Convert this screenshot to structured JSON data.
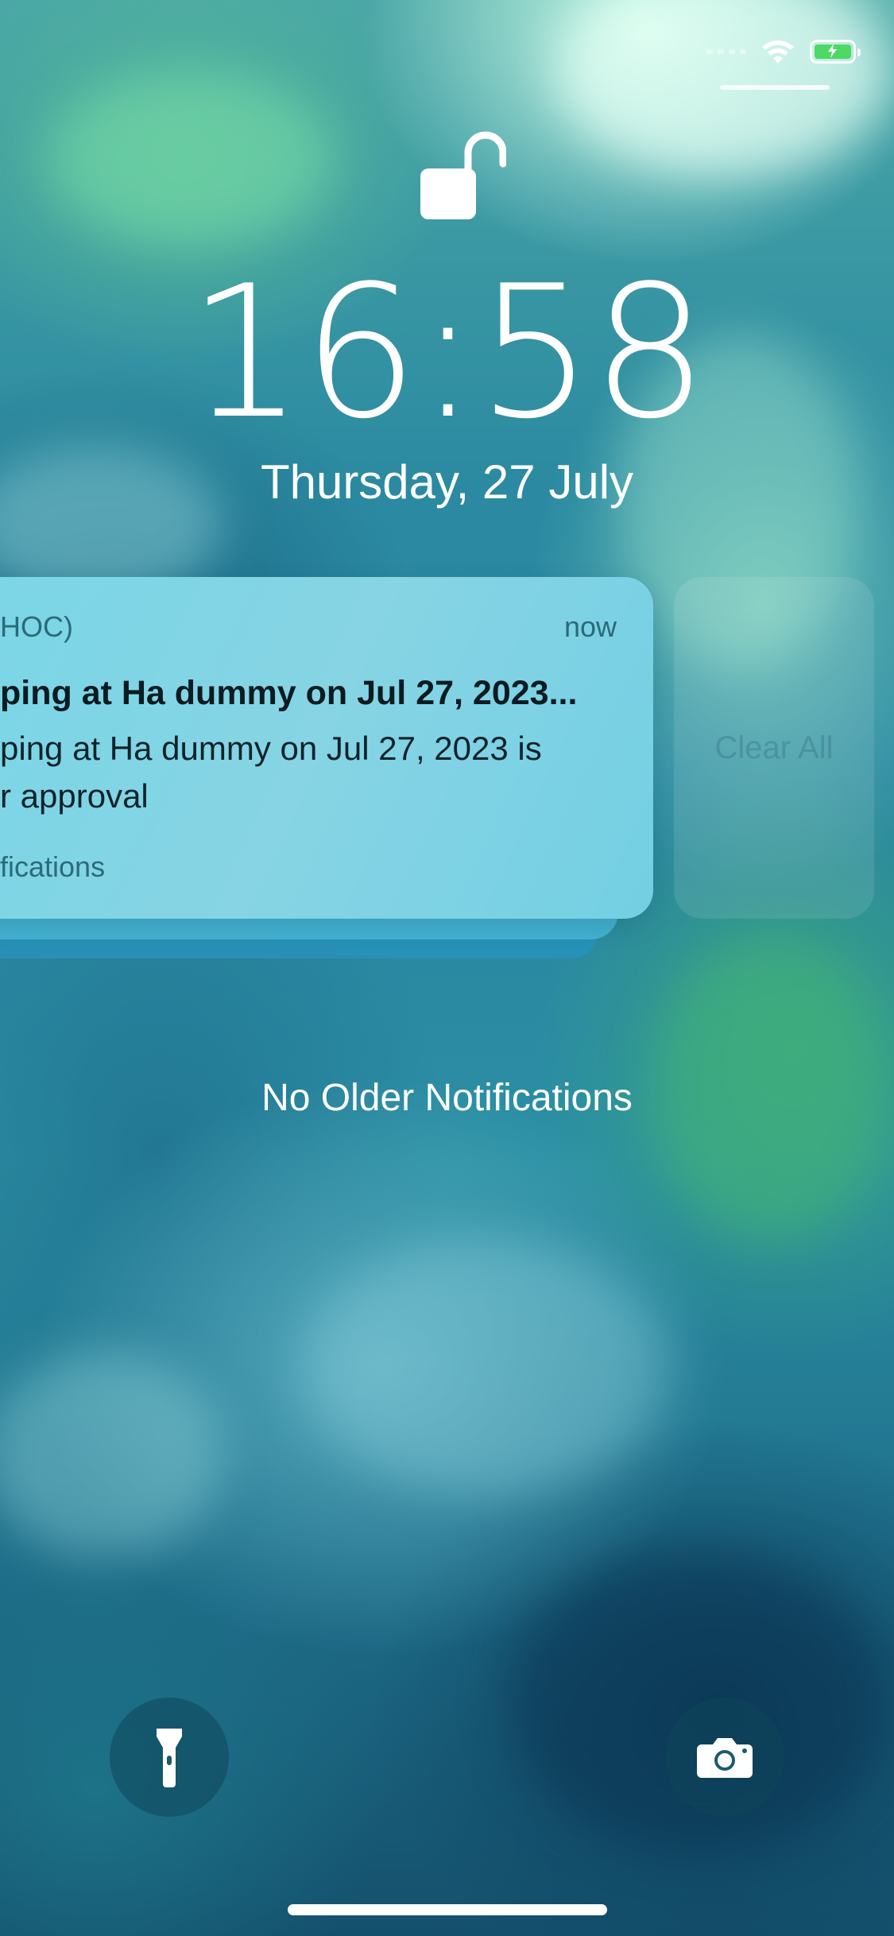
{
  "status_bar": {
    "wifi_icon": "wifi-icon",
    "battery_icon": "battery-charging-icon",
    "battery_color": "#4cd964"
  },
  "lock_screen": {
    "lock_icon": "unlocked-padlock-icon",
    "time": "16:58",
    "date": "Thursday, 27 July"
  },
  "notification": {
    "app_name": "HOC)",
    "timestamp": "now",
    "title": "ping at Ha dummy on Jul 27, 2023...",
    "body_lines": [
      "ping at Ha dummy on Jul 27, 2023 is",
      "r approval"
    ],
    "more_label": "fications"
  },
  "clear_all": {
    "label": "Clear All"
  },
  "no_older_label": "No Older Notifications",
  "quick_actions": {
    "flashlight_icon": "flashlight-icon",
    "camera_icon": "camera-icon"
  }
}
